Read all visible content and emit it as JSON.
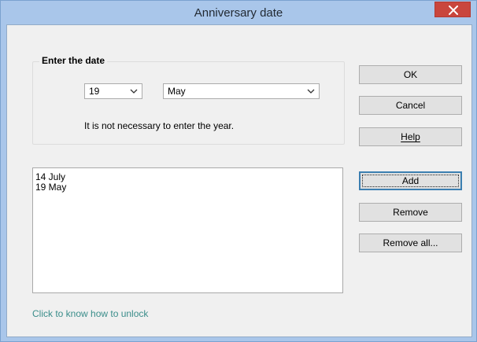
{
  "window": {
    "title": "Anniversary date"
  },
  "date_group": {
    "label": "Enter the date",
    "day_value": "19",
    "month_value": "May",
    "hint": "It is not necessary to enter the year."
  },
  "buttons": {
    "ok": "OK",
    "cancel": "Cancel",
    "help": "Help",
    "add": "Add",
    "remove": "Remove",
    "remove_all": "Remove all..."
  },
  "dates_list": [
    "14 July",
    "19 May"
  ],
  "unlock_link": "Click to know how to unlock",
  "icons": {
    "close": "close-icon",
    "dropdown": "chevron-down-icon"
  },
  "colors": {
    "titlebar": "#a9c6ea",
    "close_button": "#c9463d",
    "link": "#3a8d8a",
    "client_background": "#f0f0f0"
  }
}
